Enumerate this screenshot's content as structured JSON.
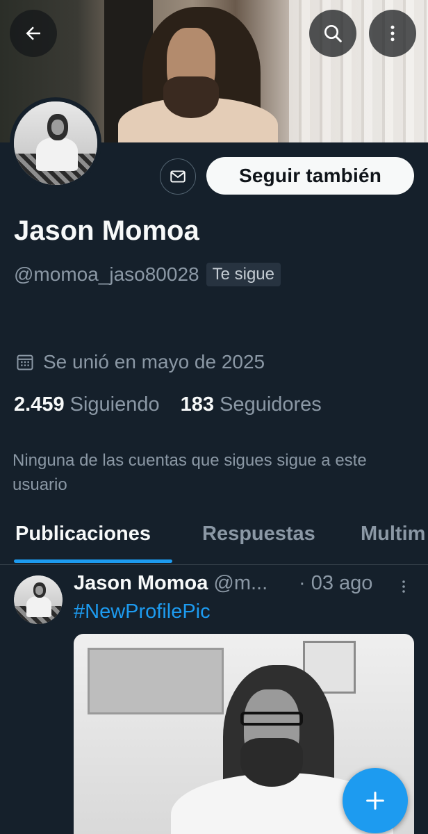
{
  "profile": {
    "name": "Jason Momoa",
    "handle": "@momoa_jaso80028",
    "follows_you_badge": "Te sigue",
    "joined": "Se unió en mayo de 2025",
    "following_count": "2.459",
    "following_label": "Siguiendo",
    "followers_count": "183",
    "followers_label": "Seguidores",
    "followed_by_note": "Ninguna de las cuentas que sigues sigue a este usuario"
  },
  "actions": {
    "follow_label": "Seguir también"
  },
  "tabs": [
    {
      "label": "Publicaciones",
      "active": true
    },
    {
      "label": "Respuestas",
      "active": false
    },
    {
      "label": "Multim",
      "active": false
    }
  ],
  "post": {
    "name": "Jason Momoa",
    "handle": "@m...",
    "date": "· 03 ago",
    "text": "#NewProfilePic"
  },
  "icons": {
    "back": "back-arrow-icon",
    "search": "search-icon",
    "more": "more-vertical-icon",
    "message": "envelope-icon",
    "calendar": "calendar-icon",
    "compose": "plus-icon"
  },
  "colors": {
    "background": "#15202b",
    "accent": "#1d9bf0",
    "text_primary": "#f7f9f9",
    "text_secondary": "#8b98a5"
  }
}
